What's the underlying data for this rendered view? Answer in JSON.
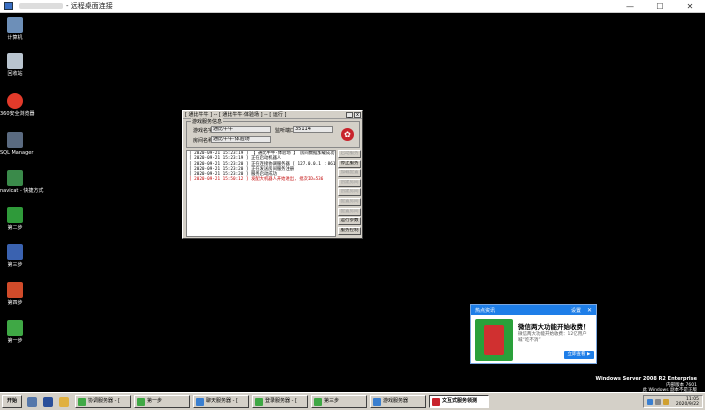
{
  "rdp": {
    "title": "- 远程桌面连接",
    "controls": [
      "—",
      "☐",
      "✕"
    ]
  },
  "desktop": {
    "icons": [
      {
        "label": "计算机",
        "color": "#6d8fb8"
      },
      {
        "label": "回收站",
        "color": "#b9c4cf"
      },
      {
        "label": "360安全浏览器",
        "color": "#e23a2a"
      },
      {
        "label": "SQL Manager",
        "color": "#5a6a80"
      },
      {
        "label": "navicat - 快捷方式",
        "color": "#3a8a4a"
      },
      {
        "label": "第二步",
        "color": "#2f9a3a"
      },
      {
        "label": "第三步",
        "color": "#3a62b0"
      },
      {
        "label": "第四步",
        "color": "#d04b2a"
      },
      {
        "label": "第一步",
        "color": "#3fa845"
      }
    ]
  },
  "window": {
    "title": "[ 通比牛牛 ] -- [ 通比牛牛·体验场 ] -- [ 运行 ]",
    "group_title": "游戏服务信息",
    "game_name_label": "游戏名字:",
    "game_name_value": "通比牛牛",
    "listen_port_label": "监听端口:",
    "listen_port_value": "35114",
    "room_name_label": "房间名称:",
    "room_name_value": "通比牛牛·体验场",
    "logo_glyph": "✿",
    "log": [
      {
        "text": "[ 2020-09-21 15:23:19 ] 【 通比牛牛·体验场 】 房间数据加载成功",
        "red": false
      },
      {
        "text": "[ 2020-09-21 15:23:19 ] 正在启动机器人",
        "red": false
      },
      {
        "text": "[ 2020-09-21 15:23:20 ] 正在连接协调服务器 [ 127.0.0.1 ︰8610 ]",
        "red": false
      },
      {
        "text": "[ 2020-09-21 15:23:20 ] 正在发送房间服务注册",
        "red": false
      },
      {
        "text": "[ 2020-09-21 15:23:20 ] 服务启动成功",
        "red": false
      },
      {
        "text": "[ 2020-09-21 15:50:12 ] 发配大机器人开始进出, 批次ID=536",
        "red": true
      }
    ],
    "buttons": [
      {
        "label": "启动服务",
        "disabled": true
      },
      {
        "label": "停止服务",
        "disabled": false
      },
      {
        "label": "加载配置",
        "disabled": true
      },
      {
        "label": "创建房间",
        "disabled": true
      },
      {
        "label": "创建房间",
        "disabled": true
      },
      {
        "label": "配置房间",
        "disabled": true
      },
      {
        "label": "配置房间",
        "disabled": true
      },
      {
        "label": "运行参数",
        "disabled": false
      },
      {
        "label": "服务控制",
        "disabled": false
      }
    ]
  },
  "popup": {
    "header": "热点资讯",
    "settings": "设置",
    "close": "✕",
    "headline": "微信两大功能开始收费！",
    "body": "微信两大功能开始收费：12亿用户喊“吃不消”",
    "button": "立即查看 ▶"
  },
  "watermark": {
    "line1": "Windows Server 2008 R2 Enterprise",
    "line2": "内部版本 7601",
    "line3": "此 Windows 副本不是正版"
  },
  "taskbar": {
    "start_label": "开始",
    "quick_launch": [
      {
        "name": "server-manager-icon",
        "color": "#5577aa"
      },
      {
        "name": "powershell-icon",
        "color": "#2a4f9a"
      },
      {
        "name": "explorer-icon",
        "color": "#e0b040"
      }
    ],
    "tasks": [
      {
        "label": "协调服务器 - [",
        "color": "#3fa845",
        "active": false
      },
      {
        "label": "第一步",
        "color": "#3fa845",
        "active": false
      },
      {
        "label": "聊天服务器 - [",
        "color": "#3a7fd0",
        "active": false
      },
      {
        "label": "登录服务器 - [",
        "color": "#3fa845",
        "active": false
      },
      {
        "label": "第三步",
        "color": "#3fa845",
        "active": false
      },
      {
        "label": "游戏服务器",
        "color": "#3a7fd0",
        "active": false
      },
      {
        "label": "文互式服务领测",
        "color": "#c8232c",
        "active": true
      }
    ],
    "clock_time": "11:05",
    "clock_date": "2020/9/22"
  }
}
